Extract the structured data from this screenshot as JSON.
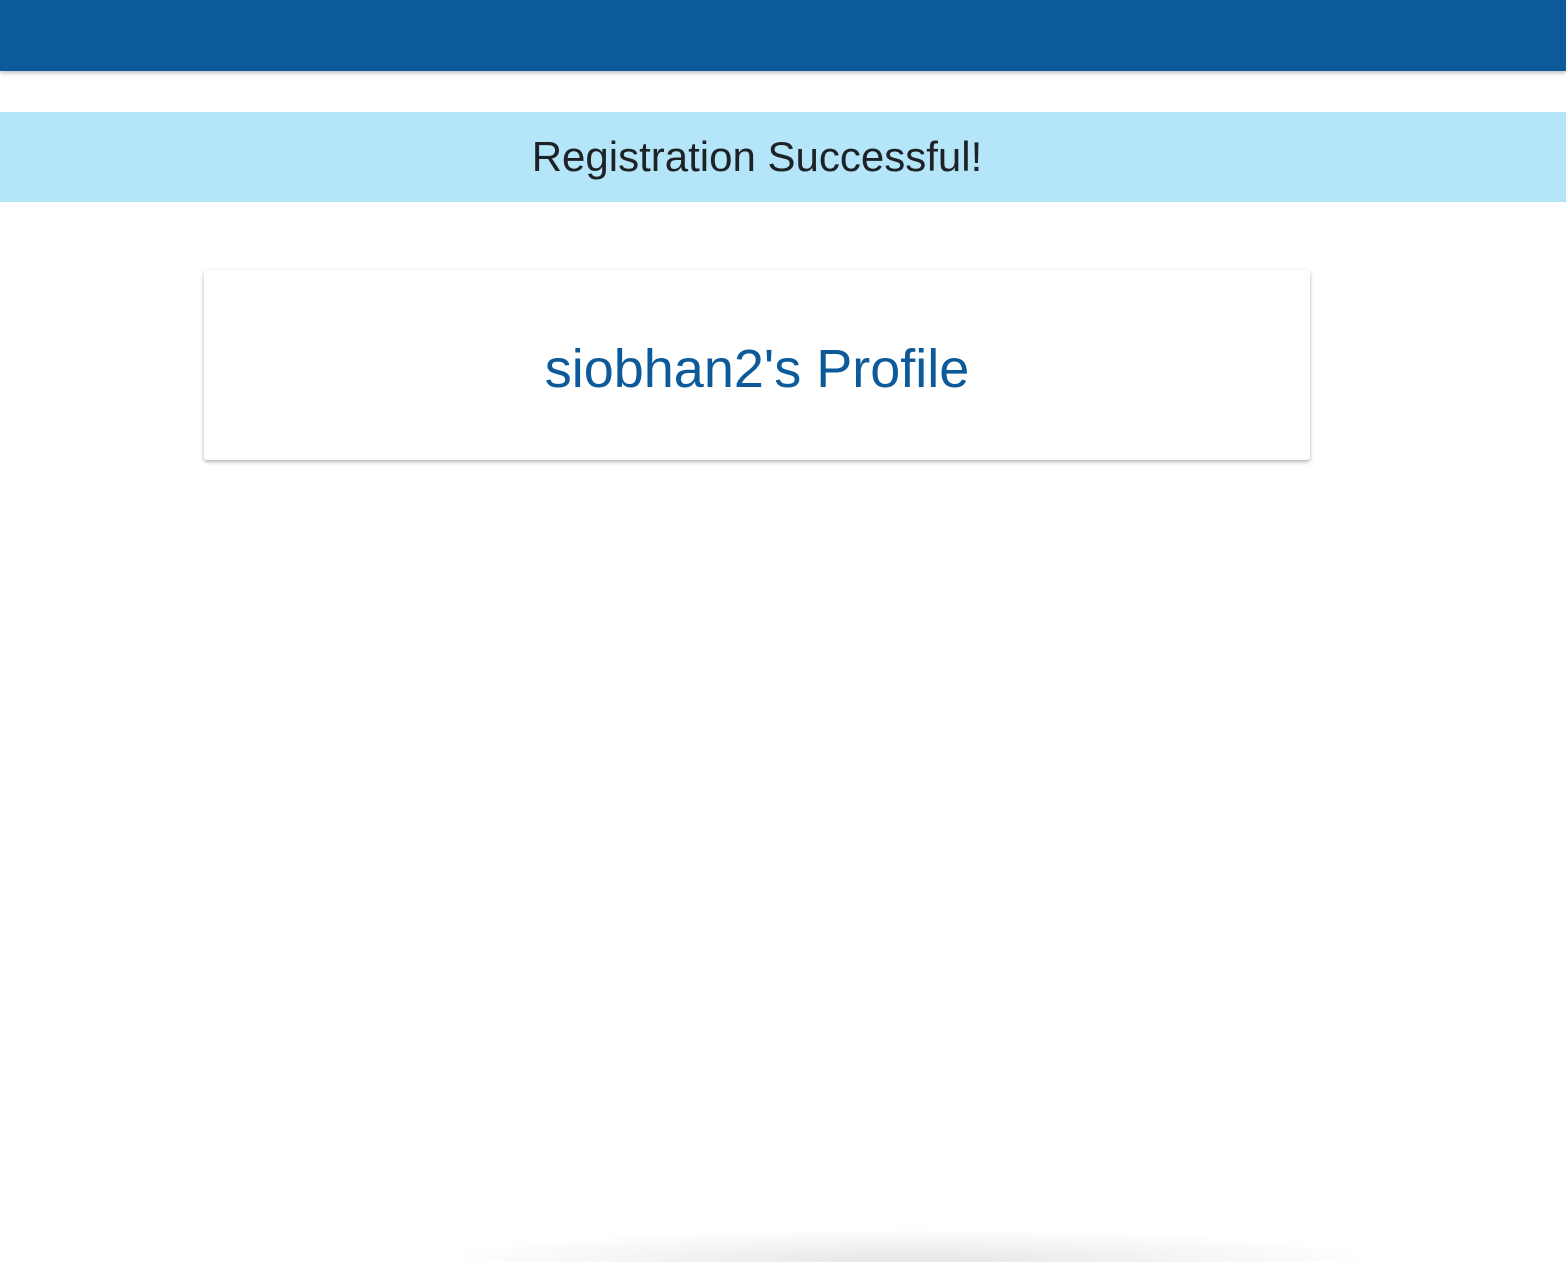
{
  "header": {
    "brand_color": "#0c5a99"
  },
  "alert": {
    "message": "Registration Successful!",
    "background_color": "#b5e5f8"
  },
  "profile": {
    "title": "siobhan2's Profile",
    "title_color": "#0c5a99"
  }
}
